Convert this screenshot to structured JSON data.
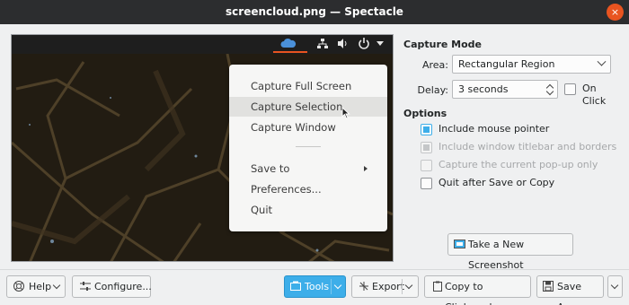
{
  "window": {
    "title": "screencloud.png — Spectacle",
    "close_glyph": "×"
  },
  "preview": {
    "topbar_icons": [
      "screencloud-icon",
      "network-icon",
      "volume-icon",
      "power-icon",
      "menu-caret-icon"
    ],
    "accent_color": "#e95420",
    "menu": {
      "items": [
        {
          "label": "Capture Full Screen"
        },
        {
          "label": "Capture Selection"
        },
        {
          "label": "Capture Window"
        },
        {
          "label": "Save to"
        },
        {
          "label": "Preferences..."
        },
        {
          "label": "Quit"
        }
      ]
    }
  },
  "capture_mode": {
    "header": "Capture Mode",
    "area_label": "Area:",
    "area_value": "Rectangular Region",
    "delay_label": "Delay:",
    "delay_value": "3 seconds",
    "on_click_label": "On Click"
  },
  "options": {
    "header": "Options",
    "include_mouse_pointer": "Include mouse pointer",
    "include_titlebar": "Include window titlebar and borders",
    "capture_popup": "Capture the current pop-up only",
    "quit_after_save": "Quit after Save or Copy"
  },
  "new_screenshot_button": "Take a New Screenshot",
  "toolbar": {
    "help": "Help",
    "configure": "Configure...",
    "tools": "Tools",
    "export": "Export",
    "copy_to_clipboard": "Copy to Clipboard",
    "save_as": "Save As..."
  },
  "colors": {
    "primary": "#3daee9",
    "titlebar": "#2c2d2f",
    "background": "#eff0f1"
  }
}
